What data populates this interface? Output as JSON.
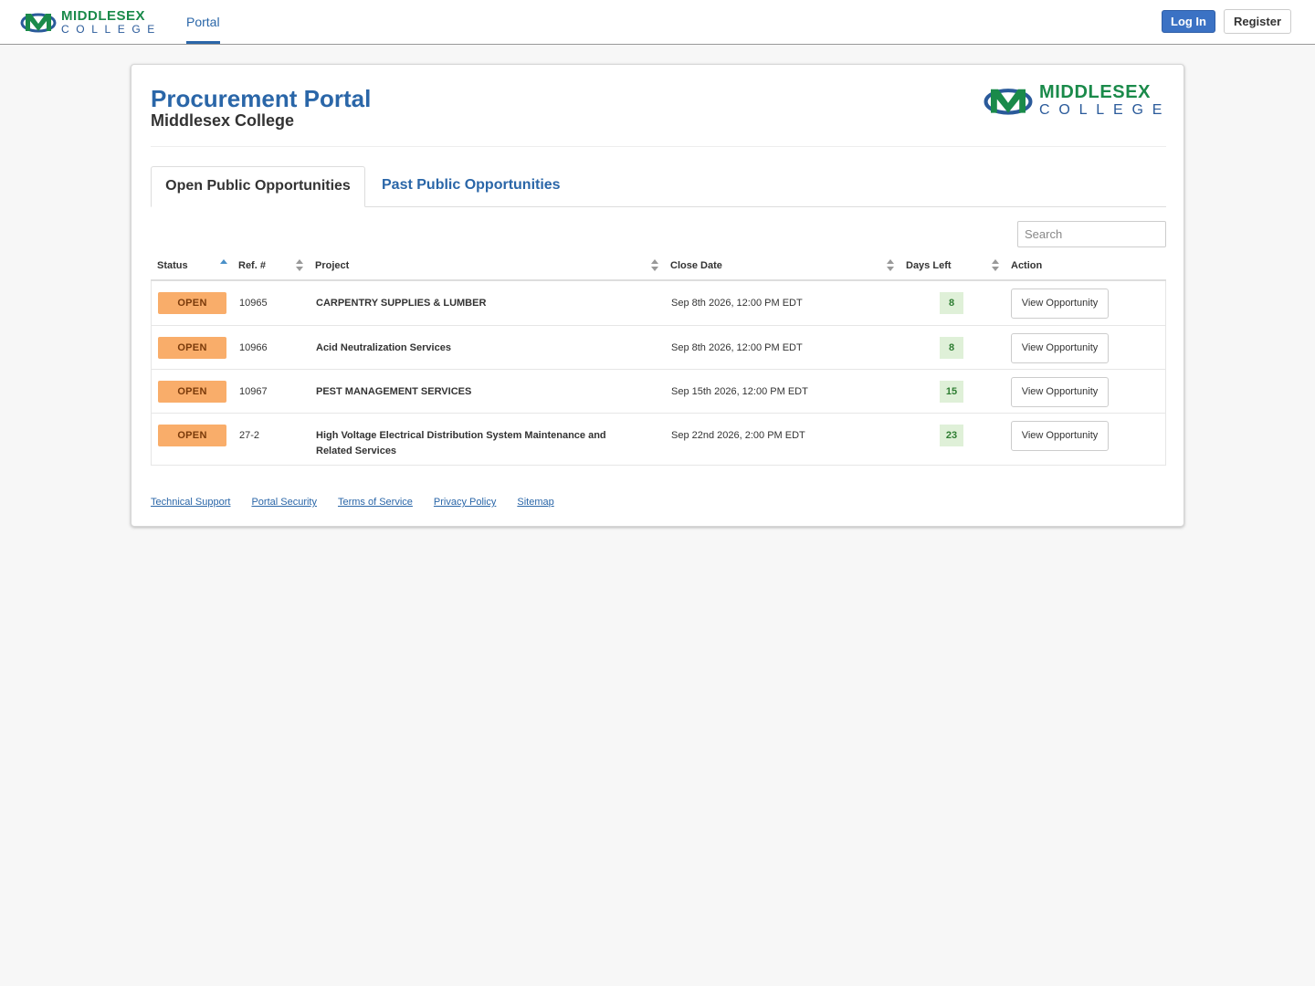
{
  "header": {
    "logo_line1": "MIDDLESEX",
    "logo_line2": "COLLEGE",
    "nav_portal": "Portal",
    "login_label": "Log In",
    "register_label": "Register"
  },
  "page": {
    "title": "Procurement Portal",
    "subtitle": "Middlesex College"
  },
  "tabs": [
    {
      "label": "Open Public Opportunities",
      "active": true
    },
    {
      "label": "Past Public Opportunities",
      "active": false
    }
  ],
  "search": {
    "placeholder": "Search",
    "value": ""
  },
  "table": {
    "columns": [
      "Status",
      "Ref. #",
      "Project",
      "Close Date",
      "Days Left",
      "Action"
    ],
    "rows": [
      {
        "status": "OPEN",
        "ref": "10965",
        "project": "CARPENTRY SUPPLIES & LUMBER",
        "close_date": "Sep 8th 2026, 12:00 PM EDT",
        "days_left": "8",
        "action": "View Opportunity"
      },
      {
        "status": "OPEN",
        "ref": "10966",
        "project": "Acid Neutralization Services",
        "close_date": "Sep 8th 2026, 12:00 PM EDT",
        "days_left": "8",
        "action": "View Opportunity"
      },
      {
        "status": "OPEN",
        "ref": "10967",
        "project": "PEST MANAGEMENT SERVICES",
        "close_date": "Sep 15th 2026, 12:00 PM EDT",
        "days_left": "15",
        "action": "View Opportunity"
      },
      {
        "status": "OPEN",
        "ref": "27-2",
        "project": "High Voltage Electrical Distribution System Maintenance and Related Services",
        "close_date": "Sep 22nd 2026, 2:00 PM EDT",
        "days_left": "23",
        "action": "View Opportunity"
      }
    ]
  },
  "footer": {
    "links": [
      "Technical Support",
      "Portal Security",
      "Terms of Service",
      "Privacy Policy",
      "Sitemap"
    ]
  },
  "colors": {
    "primary_blue": "#2a66a8",
    "brand_green": "#1a8a4a",
    "open_badge": "#f9ad6a",
    "days_badge": "#dff0d8"
  }
}
